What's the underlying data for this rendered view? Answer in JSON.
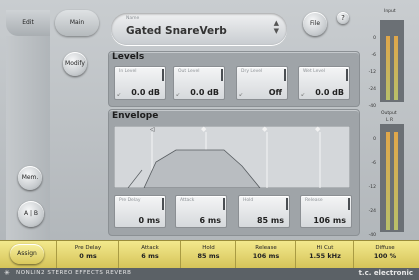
{
  "tabs": {
    "edit": "Edit",
    "main": "Main"
  },
  "buttons": {
    "modify": "Modify",
    "file": "File",
    "help": "?",
    "mem": "Mem.",
    "a": "A",
    "b": "B",
    "assign": "Assign"
  },
  "preset": {
    "caption": "Name",
    "name": "Gated SnareVerb",
    "up_icon": "arrow-up-icon",
    "down_icon": "arrow-down-icon"
  },
  "levels": {
    "title": "Levels",
    "params": [
      {
        "label": "In Level",
        "value": "0.0 dB"
      },
      {
        "label": "Out Level",
        "value": "0.0 dB"
      },
      {
        "label": "Dry Level",
        "value": "Off"
      },
      {
        "label": "Wet Level",
        "value": "0.0 dB"
      }
    ]
  },
  "envelope": {
    "title": "Envelope",
    "params": [
      {
        "label": "Pre Delay",
        "value": "0 ms"
      },
      {
        "label": "Attack",
        "value": "6 ms"
      },
      {
        "label": "Hold",
        "value": "85 ms"
      },
      {
        "label": "Release",
        "value": "106 ms"
      }
    ]
  },
  "meters": {
    "input_title": "Input",
    "output_title": "Output",
    "lr_label": "L R",
    "scale_input": [
      "0",
      "-6",
      "-12",
      "-24",
      "-40"
    ],
    "scale_output": [
      "0",
      "-6",
      "-12",
      "-24",
      "-40"
    ]
  },
  "bottom_bar": [
    {
      "label": "Pre Delay",
      "value": "0 ms"
    },
    {
      "label": "Attack",
      "value": "6 ms"
    },
    {
      "label": "Hold",
      "value": "85 ms"
    },
    {
      "label": "Release",
      "value": "106 ms"
    },
    {
      "label": "Hi Cut",
      "value": "1.55 kHz"
    },
    {
      "label": "Diffuse",
      "value": "100 %"
    }
  ],
  "footer": {
    "left": "NONLIN2 STEREO EFFECTS REVERB",
    "right": "t.c. electronic"
  },
  "colors": {
    "accent_yellow": "#e9dc74",
    "meter_green": "#b8c06a",
    "meter_orange": "#e0a64a"
  }
}
